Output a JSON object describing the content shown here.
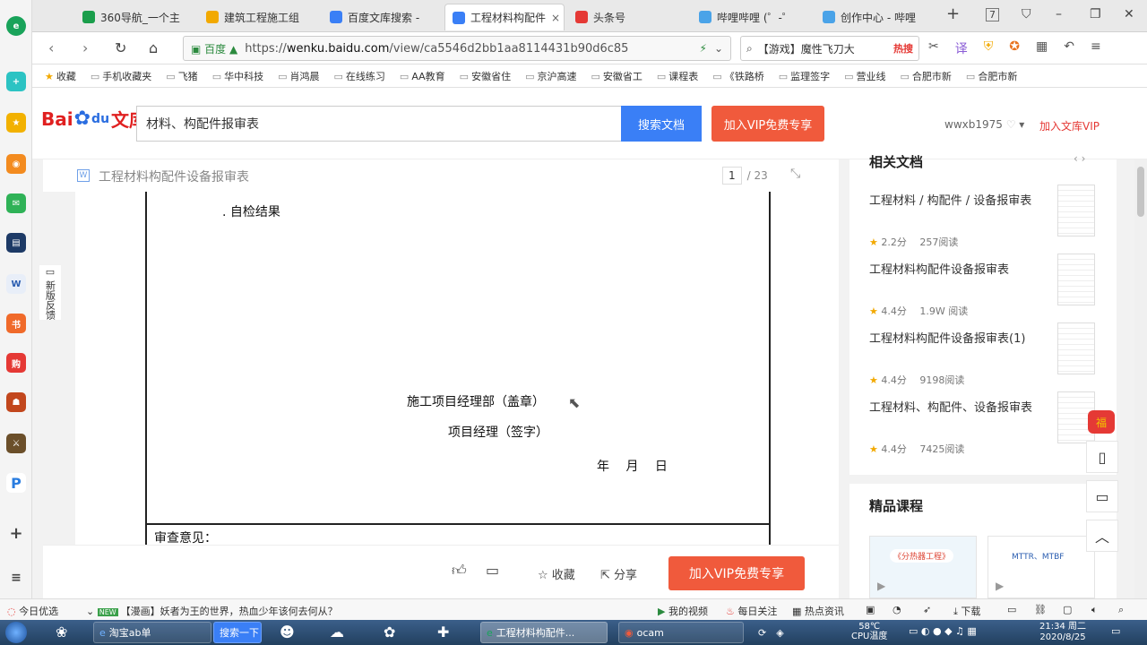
{
  "tabs": [
    {
      "label": "360导航_一个主",
      "color": "#1a9e4b"
    },
    {
      "label": "建筑工程施工组",
      "color": "#f2a900"
    },
    {
      "label": "百度文库搜索 -",
      "color": "#3a7ff6"
    },
    {
      "label": "工程材料构配件",
      "color": "#3a7ff6",
      "close": "×"
    },
    {
      "label": "头条号",
      "color": "#e53935"
    },
    {
      "label": "哔哩哔哩 (゜-゜",
      "color": "#4aa3e8"
    },
    {
      "label": "创作中心 - 哔哩",
      "color": "#4aa3e8"
    }
  ],
  "window_controls": {
    "new_tab": "+",
    "count": "7",
    "shirt": "⛉",
    "minimize": "–",
    "restore": "❐",
    "close": "✕"
  },
  "address": {
    "secure_label": "百度",
    "url_prefix": "https://",
    "url_host": "wenku.baidu.com",
    "url_path": "/view/ca5546d2bb1aa8114431b90d6c85"
  },
  "side_search": {
    "text": "【游戏】魔性飞刀大",
    "hot": "热搜"
  },
  "bookmarks": [
    "收藏",
    "手机收藏夹",
    "飞猪",
    "华中科技",
    "肖鸿晨",
    "在线练习",
    "AA教育",
    "安徽省住",
    "京沪高速",
    "安徽省工",
    "课程表",
    "《铁路桥",
    "监理签字",
    "营业线",
    "合肥市新",
    "合肥市新"
  ],
  "header": {
    "logo_bai": "Bai",
    "logo_du": "du",
    "logo_wk": "文库",
    "query": "材料、构配件报审表",
    "search_btn": "搜索文档",
    "vip_btn": "加入VIP免费专享",
    "user": "wwxb1975",
    "join_vip": "加入文库VIP"
  },
  "doc": {
    "title": "工程材料构配件设备报审表",
    "page": "1",
    "total": "/ 23",
    "lines": {
      "self_check": ". 自检结果",
      "dept": "施工项目经理部（盖章）",
      "manager": "项目经理（签字）",
      "date": "年　 月　 日",
      "review": "审查意见："
    }
  },
  "feedback": "新版反馈",
  "bottombar": {
    "collect": "收藏",
    "share": "分享",
    "vip": "加入VIP免费专享"
  },
  "related": {
    "heading": "相关文档",
    "items": [
      {
        "title": "工程材料 / 构配件 / 设备报审表",
        "score": "2.2分",
        "reads": "257阅读"
      },
      {
        "title": "工程材料构配件设备报审表",
        "score": "4.4分",
        "reads": "1.9W 阅读"
      },
      {
        "title": "工程材料构配件设备报审表(1)",
        "score": "4.4分",
        "reads": "9198阅读"
      },
      {
        "title": "工程材料、构配件、设备报审表",
        "score": "4.4分",
        "reads": "7425阅读"
      }
    ]
  },
  "courses": {
    "heading": "精品课程",
    "items": [
      "《分热器工程》",
      "MTTR、MTBF"
    ]
  },
  "statusbar": {
    "today": "今日优选",
    "new_badge": "NEW",
    "headline": "【漫画】妖者为王的世界，热血少年该何去何从？",
    "my_video": "我的视频",
    "daily": "每日关注",
    "hot": "热点资讯",
    "download": "下载"
  },
  "taskbar": {
    "items": [
      "淘宝ab单",
      "搜索一下",
      "工程材料构配件...",
      "ocam"
    ],
    "temp": "58℃",
    "temp_sub": "CPU温度",
    "time": "21:34 周二",
    "date": "2020/8/25"
  }
}
